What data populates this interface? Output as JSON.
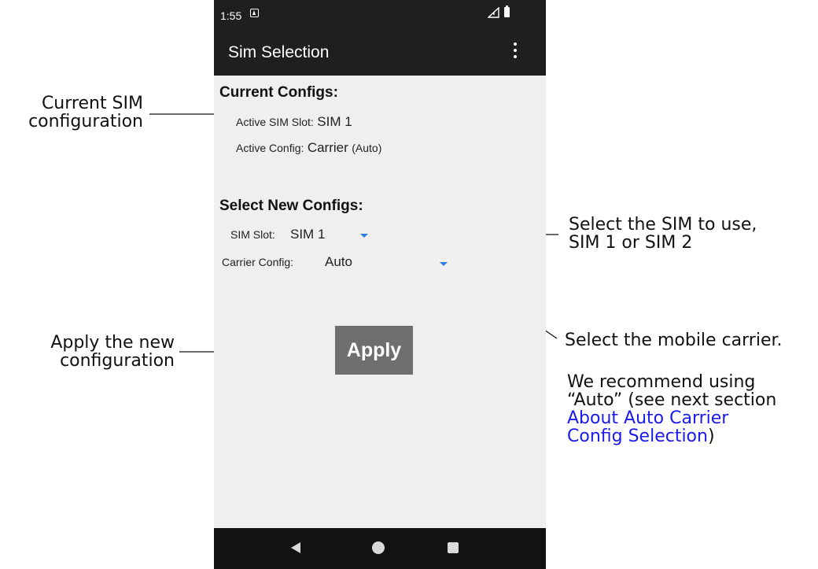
{
  "status_bar": {
    "time": "1:55"
  },
  "app_bar": {
    "title": "Sim Selection"
  },
  "current": {
    "heading": "Current Configs:",
    "slot_label": "Active SIM Slot:",
    "slot_value": "SIM 1",
    "config_label": "Active Config:",
    "config_value": "Carrier",
    "config_note": "(Auto)"
  },
  "select": {
    "heading": "Select New Configs:",
    "sim_slot_label": "SIM Slot:",
    "sim_slot_value": "SIM 1",
    "carrier_label": "Carrier Config:",
    "carrier_value": "Auto"
  },
  "apply_label": "Apply",
  "callouts": {
    "current_sim": [
      "Current SIM",
      "configuration"
    ],
    "select_sim": [
      "Select the SIM to use,",
      "SIM 1 or SIM 2"
    ],
    "select_carrier": "Select the mobile carrier.",
    "recommend_1": "We recommend using",
    "recommend_2": "“Auto” (see next section",
    "link_1": "About Auto Carrier",
    "link_2": "Config Selection",
    "link_suffix": ")",
    "apply": [
      "Apply the new",
      "configuration"
    ]
  },
  "colors": {
    "accent": "#2f7de1",
    "app_bar": "#1f1f1f",
    "apply_button": "#6f6f6f",
    "link": "#1a1aee"
  },
  "icons": [
    "notification-icon",
    "signal-icon",
    "battery-icon",
    "overflow-menu-icon",
    "dropdown-arrow-icon",
    "back-icon",
    "home-icon",
    "recents-icon"
  ]
}
